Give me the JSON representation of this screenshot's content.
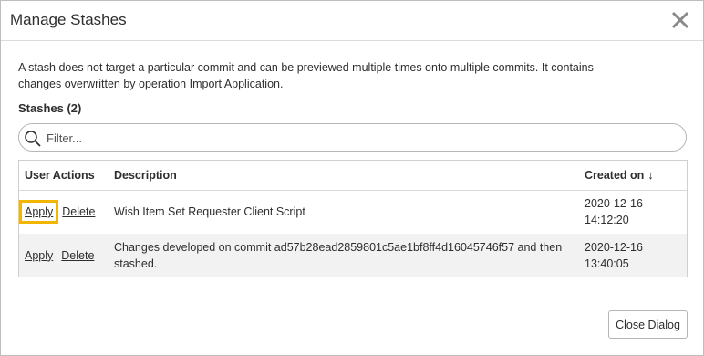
{
  "dialog": {
    "title": "Manage Stashes",
    "close_icon": "close-icon",
    "description": "A stash does not target a particular commit and can be previewed multiple times onto multiple commits. It contains changes overwritten by operation Import Application.",
    "stashes_heading": "Stashes (2)",
    "filter": {
      "placeholder": "Filter...",
      "value": "",
      "icon": "search-icon"
    },
    "table": {
      "headers": {
        "actions": "User Actions",
        "description": "Description",
        "created": "Created on",
        "sort_indicator": "↓"
      },
      "rows": [
        {
          "apply": "Apply",
          "delete": "Delete",
          "description": "Wish Item Set Requester Client Script",
          "created_date": "2020-12-16",
          "created_time": "14:12:20",
          "highlighted": true
        },
        {
          "apply": "Apply",
          "delete": "Delete",
          "description": "Changes developed on commit ad57b28ead2859801c5ae1bf8ff4d16045746f57 and then stashed.",
          "created_date": "2020-12-16",
          "created_time": "13:40:05",
          "highlighted": false
        }
      ]
    },
    "close_button": "Close Dialog"
  },
  "colors": {
    "highlight": "#f2b600",
    "text": "#2e2e2e",
    "row_alt": "#f2f2f2"
  }
}
